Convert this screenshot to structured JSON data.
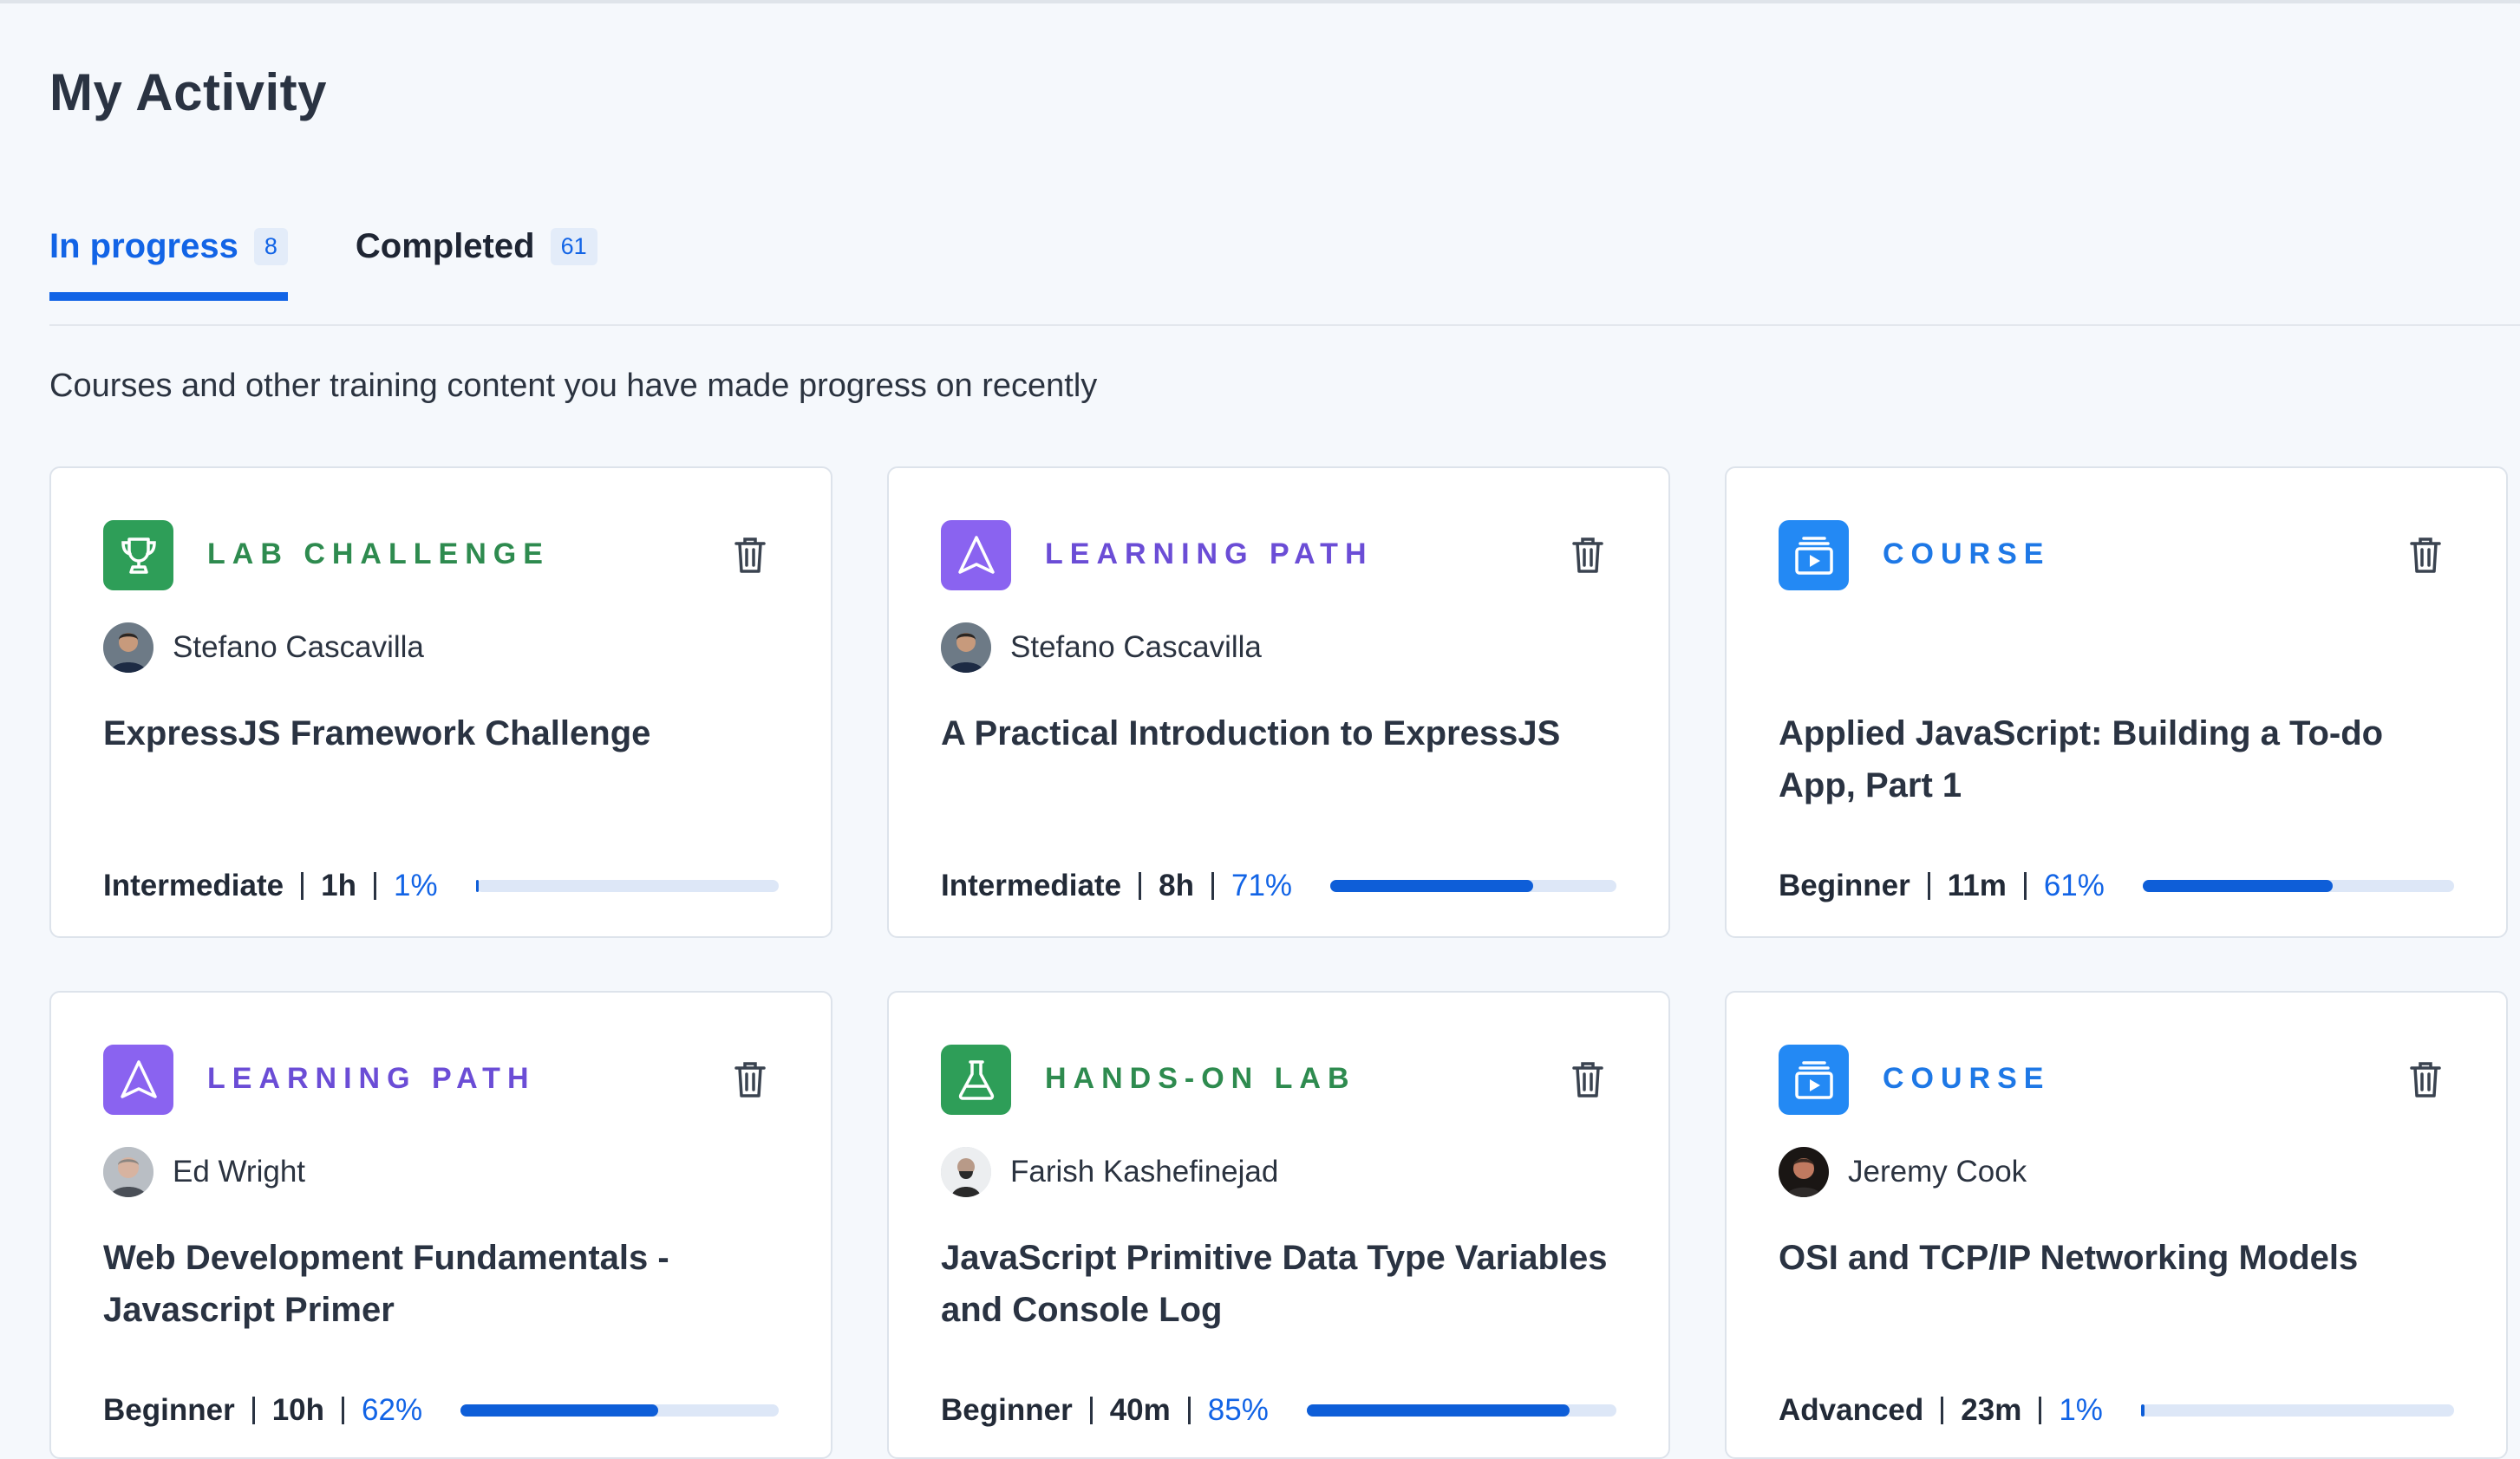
{
  "page": {
    "title": "My Activity"
  },
  "tabs": [
    {
      "label": "In progress",
      "count": "8",
      "active": true
    },
    {
      "label": "Completed",
      "count": "61",
      "active": false
    }
  ],
  "subtitle": "Courses and other training content you have made progress on recently",
  "colors": {
    "accent": "#1264e6",
    "lab_green": "#2e9e58",
    "path_purple": "#8a63f0",
    "course_blue": "#2389f4",
    "progress_fill": "#0e5ed8",
    "progress_track": "#dde7f7"
  },
  "cards": [
    {
      "type": "LAB CHALLENGE",
      "icon": "trophy-icon",
      "author": "Stefano Cascavilla",
      "title": "ExpressJS Framework Challenge",
      "level": "Intermediate",
      "duration": "1h",
      "percent": "1%",
      "progress": 0.01
    },
    {
      "type": "LEARNING PATH",
      "icon": "path-arrow-icon",
      "author": "Stefano Cascavilla",
      "title": "A Practical Introduction to ExpressJS",
      "level": "Intermediate",
      "duration": "8h",
      "percent": "71%",
      "progress": 0.71
    },
    {
      "type": "COURSE",
      "icon": "course-play-icon",
      "author": "",
      "title": "Applied JavaScript: Building a To-do App, Part 1",
      "level": "Beginner",
      "duration": "11m",
      "percent": "61%",
      "progress": 0.61
    },
    {
      "type": "LEARNING PATH",
      "icon": "path-arrow-icon",
      "author": "Ed Wright",
      "title": "Web Development Fundamentals - Javascript Primer",
      "level": "Beginner",
      "duration": "10h",
      "percent": "62%",
      "progress": 0.62
    },
    {
      "type": "HANDS-ON LAB",
      "icon": "flask-icon",
      "author": "Farish Kashefinejad",
      "title": "JavaScript Primitive Data Type Variables and Console Log",
      "level": "Beginner",
      "duration": "40m",
      "percent": "85%",
      "progress": 0.85
    },
    {
      "type": "COURSE",
      "icon": "course-play-icon",
      "author": "Jeremy Cook",
      "title": "OSI and TCP/IP Networking Models",
      "level": "Advanced",
      "duration": "23m",
      "percent": "1%",
      "progress": 0.01
    }
  ]
}
